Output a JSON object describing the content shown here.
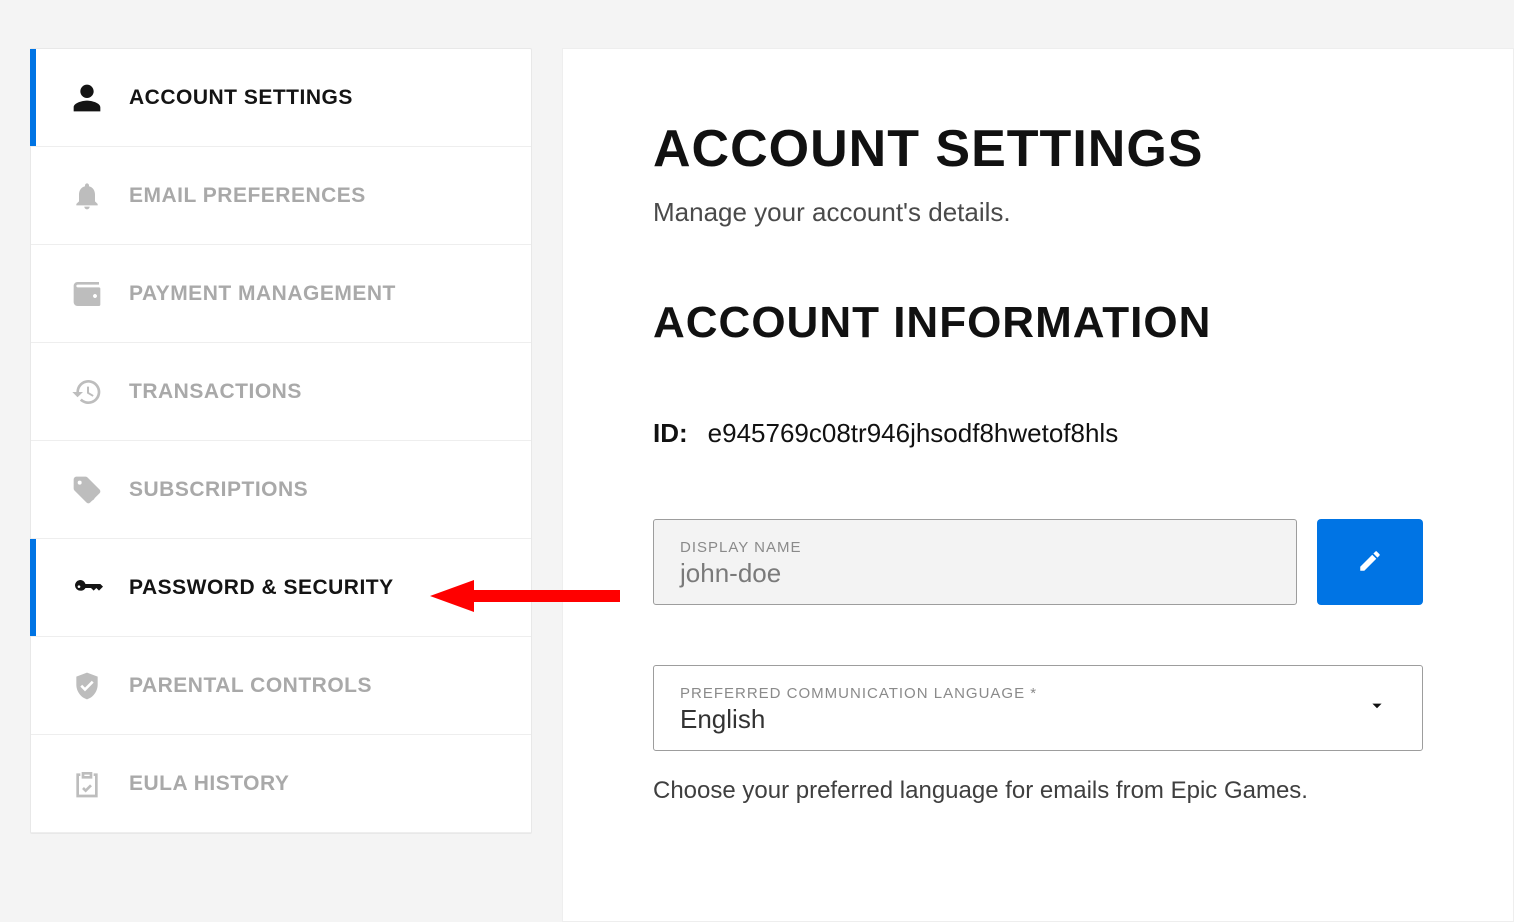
{
  "sidebar": {
    "items": [
      {
        "label": "ACCOUNT SETTINGS"
      },
      {
        "label": "EMAIL PREFERENCES"
      },
      {
        "label": "PAYMENT MANAGEMENT"
      },
      {
        "label": "TRANSACTIONS"
      },
      {
        "label": "SUBSCRIPTIONS"
      },
      {
        "label": "PASSWORD & SECURITY"
      },
      {
        "label": "PARENTAL CONTROLS"
      },
      {
        "label": "EULA HISTORY"
      }
    ]
  },
  "page": {
    "title": "ACCOUNT SETTINGS",
    "subtitle": "Manage your account's details."
  },
  "section": {
    "title": "ACCOUNT INFORMATION",
    "id_label": "ID:",
    "id_value": "e945769c08tr946jhsodf8hwetof8hls"
  },
  "display_name": {
    "label": "DISPLAY NAME",
    "value": "john-doe"
  },
  "language": {
    "label": "PREFERRED COMMUNICATION LANGUAGE *",
    "value": "English",
    "helper": "Choose your preferred language for emails from Epic Games."
  },
  "colors": {
    "accent": "#0074e4"
  }
}
